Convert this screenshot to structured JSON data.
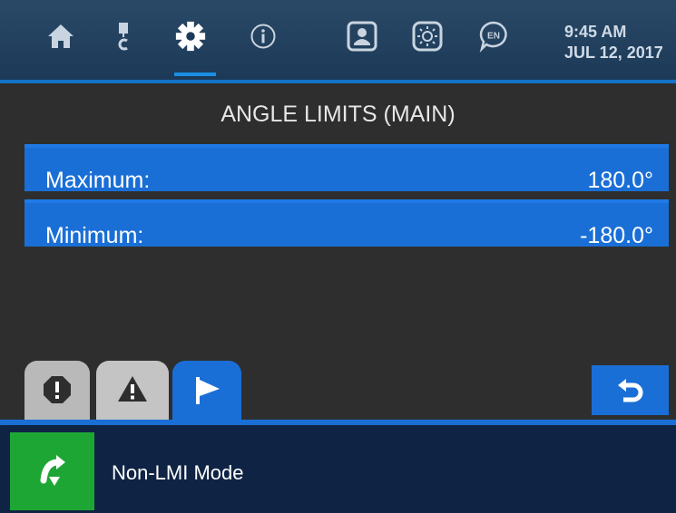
{
  "header": {
    "nav": [
      {
        "id": "home",
        "icon": "home-icon"
      },
      {
        "id": "crane",
        "icon": "crane-hook-icon"
      },
      {
        "id": "settings",
        "icon": "gear-icon",
        "active": true
      },
      {
        "id": "info",
        "icon": "info-icon"
      },
      {
        "id": "operator",
        "icon": "user-id-icon"
      },
      {
        "id": "brightness",
        "icon": "brightness-icon"
      },
      {
        "id": "language",
        "icon": "language-icon",
        "label": "EN"
      }
    ],
    "time": "9:45 AM",
    "date": "JUL 12, 2017"
  },
  "page": {
    "title": "ANGLE LIMITS (MAIN)",
    "limits": [
      {
        "label": "Maximum:",
        "value": "180.0°"
      },
      {
        "label": "Minimum:",
        "value": "-180.0°"
      }
    ]
  },
  "tabs": [
    {
      "id": "faults",
      "icon": "fault-octagon-icon"
    },
    {
      "id": "warnings",
      "icon": "warning-triangle-icon"
    },
    {
      "id": "flags",
      "icon": "flag-icon",
      "active": true
    }
  ],
  "back_icon": "back-arrow-icon",
  "status": {
    "icon": "non-lmi-mode-icon",
    "text": "Non-LMI Mode"
  },
  "colors": {
    "header_bg": "#1c3a58",
    "accent_blue": "#1a6fd6",
    "status_bg": "#0f2444",
    "mode_green": "#1ea635",
    "panel_bg": "#2e2e2e"
  }
}
